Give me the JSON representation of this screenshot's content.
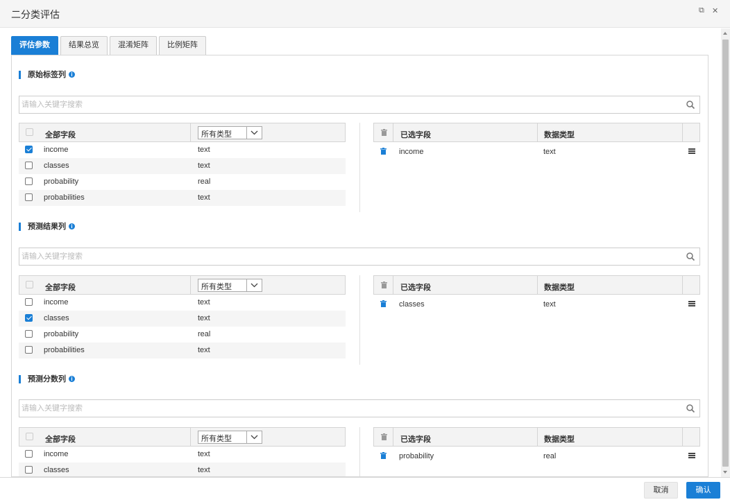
{
  "window": {
    "title": "二分类评估",
    "restore_glyph": "⧉",
    "close_glyph": "✕"
  },
  "tabs": [
    {
      "label": "评估参数",
      "active": true
    },
    {
      "label": "结果总览",
      "active": false
    },
    {
      "label": "混淆矩阵",
      "active": false
    },
    {
      "label": "比例矩阵",
      "active": false
    }
  ],
  "common": {
    "search_placeholder": "请输入关键字搜索",
    "all_fields": "全部字段",
    "type_filter": "所有类型",
    "selected_fields": "已选字段",
    "data_type": "数据类型"
  },
  "sections": [
    {
      "title": "原始标签列",
      "fields": [
        {
          "name": "income",
          "type": "text",
          "checked": true
        },
        {
          "name": "classes",
          "type": "text",
          "checked": false
        },
        {
          "name": "probability",
          "type": "real",
          "checked": false
        },
        {
          "name": "probabilities",
          "type": "text",
          "checked": false
        }
      ],
      "selected": [
        {
          "name": "income",
          "type": "text"
        }
      ]
    },
    {
      "title": "预测结果列",
      "fields": [
        {
          "name": "income",
          "type": "text",
          "checked": false
        },
        {
          "name": "classes",
          "type": "text",
          "checked": true
        },
        {
          "name": "probability",
          "type": "real",
          "checked": false
        },
        {
          "name": "probabilities",
          "type": "text",
          "checked": false
        }
      ],
      "selected": [
        {
          "name": "classes",
          "type": "text"
        }
      ]
    },
    {
      "title": "预测分数列",
      "fields": [
        {
          "name": "income",
          "type": "text",
          "checked": false
        },
        {
          "name": "classes",
          "type": "text",
          "checked": false
        }
      ],
      "selected": [
        {
          "name": "probability",
          "type": "real"
        }
      ]
    }
  ],
  "footer": {
    "cancel": "取消",
    "ok": "确认"
  },
  "colors": {
    "accent": "#1a7fd6"
  }
}
